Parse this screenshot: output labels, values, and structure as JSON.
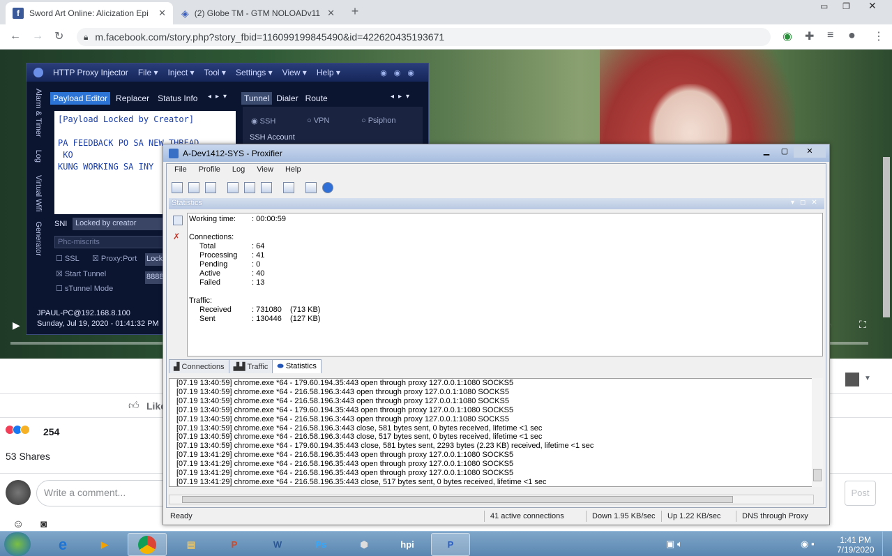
{
  "browser": {
    "tabs": [
      {
        "title": "Sword Art Online: Alicization Epi"
      },
      {
        "title": "(2) Globe TM - GTM NOLOADv11"
      }
    ],
    "url": "m.facebook.com/story.php?story_fbid=116099199845490&id=422620435193671"
  },
  "facebook": {
    "like_label": "Like",
    "reactions_count": "254",
    "shares": "53 Shares",
    "comment_placeholder": "Write a comment...",
    "post_label": "Post"
  },
  "hpi": {
    "title": "HTTP Proxy Injector",
    "menu": [
      "File",
      "Inject",
      "Tool",
      "Settings",
      "View",
      "Help"
    ],
    "left_tabs": [
      "Payload Editor",
      "Replacer",
      "Status Info"
    ],
    "right_tabs": [
      "Tunnel",
      "Dialer",
      "Route"
    ],
    "side_tabs": [
      "Alarm & Timer",
      "Log",
      "Virtual Wifi",
      "Generator"
    ],
    "payload": "[Payload Locked by Creator]\n\nPA FEEDBACK PO SA NEW THREAD\n KO\nKUNG WORKING SA INY",
    "sni_label": "SNI",
    "sni_value": "Locked by creator",
    "sni2_value": "Phc-miscrits",
    "ssl_label": "SSL",
    "proxy_port_label": "Proxy:Port",
    "proxy_value": "Lock",
    "start_tunnel_label": "Start Tunnel",
    "port_value": "8888",
    "stunnel_label": "sTunnel Mode",
    "radio_ssh": "SSH",
    "radio_vpn": "VPN",
    "radio_psiphon": "Psiphon",
    "ssh_account": "SSH Account",
    "host": "JPAUL-PC@192.168.8.100",
    "datetime": "Sunday, Jul 19, 2020 - 01:41:32 PM"
  },
  "proxifier": {
    "title": "A-Dev1412-SYS - Proxifier",
    "menu": [
      "File",
      "Profile",
      "Log",
      "View",
      "Help"
    ],
    "pane_title": "Statistics",
    "stats": {
      "working_time_label": "Working time:",
      "working_time": ": 00:00:59",
      "connections_label": "Connections:",
      "total_label": "Total",
      "total": ": 64",
      "processing_label": "Processing",
      "processing": ": 41",
      "pending_label": "Pending",
      "pending": ": 0",
      "active_label": "Active",
      "active": ": 40",
      "failed_label": "Failed",
      "failed": ": 13",
      "traffic_label": "Traffic:",
      "received_label": "Received",
      "received": ": 731080    (713 KB)",
      "sent_label": "Sent",
      "sent": ": 130446    (127 KB)"
    },
    "tabs": [
      "Connections",
      "Traffic",
      "Statistics"
    ],
    "log": [
      "[07.19 13:40:59] chrome.exe *64 - 179.60.194.35:443 open through proxy 127.0.0.1:1080 SOCKS5",
      "[07.19 13:40:59] chrome.exe *64 - 216.58.196.3:443 open through proxy 127.0.0.1:1080 SOCKS5",
      "[07.19 13:40:59] chrome.exe *64 - 216.58.196.3:443 open through proxy 127.0.0.1:1080 SOCKS5",
      "[07.19 13:40:59] chrome.exe *64 - 179.60.194.35:443 open through proxy 127.0.0.1:1080 SOCKS5",
      "[07.19 13:40:59] chrome.exe *64 - 216.58.196.3:443 open through proxy 127.0.0.1:1080 SOCKS5",
      "[07.19 13:40:59] chrome.exe *64 - 216.58.196.3:443 close, 581 bytes sent, 0 bytes received, lifetime <1 sec",
      "[07.19 13:40:59] chrome.exe *64 - 216.58.196.3:443 close, 517 bytes sent, 0 bytes received, lifetime <1 sec",
      "[07.19 13:40:59] chrome.exe *64 - 179.60.194.35:443 close, 581 bytes sent, 2293 bytes (2.23 KB) received, lifetime <1 sec",
      "[07.19 13:41:29] chrome.exe *64 - 216.58.196.35:443 open through proxy 127.0.0.1:1080 SOCKS5",
      "[07.19 13:41:29] chrome.exe *64 - 216.58.196.35:443 open through proxy 127.0.0.1:1080 SOCKS5",
      "[07.19 13:41:29] chrome.exe *64 - 216.58.196.35:443 open through proxy 127.0.0.1:1080 SOCKS5",
      "[07.19 13:41:29] chrome.exe *64 - 216.58.196.35:443 close, 517 bytes sent, 0 bytes received, lifetime <1 sec"
    ],
    "status": {
      "ready": "Ready",
      "active_connections": "41 active connections",
      "down": "Down 1.95 KB/sec",
      "up": "Up 1.22 KB/sec",
      "dns": "DNS through Proxy"
    }
  },
  "taskbar": {
    "time": "1:41 PM",
    "date": "7/19/2020",
    "apps": [
      "IE",
      "Media",
      "Chrome",
      "Explorer",
      "PowerPoint",
      "Word",
      "Photoshop",
      "Nox",
      "HPI",
      "Proxifier"
    ]
  }
}
